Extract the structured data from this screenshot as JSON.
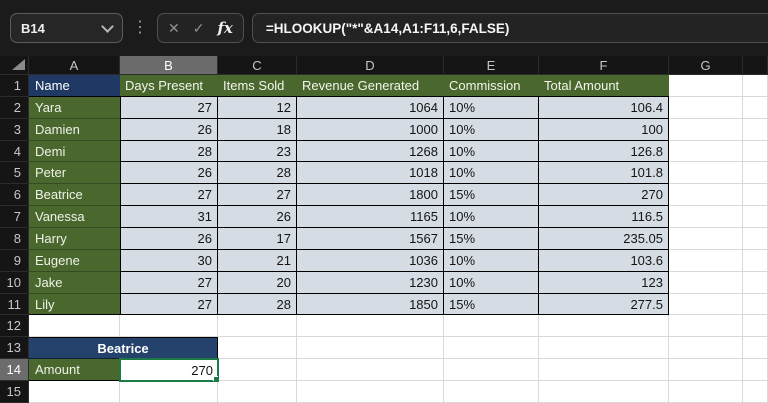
{
  "formula_bar": {
    "name_box_value": "B14",
    "kebab_icon": "⋮",
    "cancel_icon": "✕",
    "confirm_icon": "✓",
    "fx_icon": "fx",
    "formula": "=HLOOKUP(\"*\"&A14,A1:F11,6,FALSE)"
  },
  "sheet": {
    "column_headers": [
      "A",
      "B",
      "C",
      "D",
      "E",
      "F",
      "G",
      ""
    ],
    "row_headers": [
      "1",
      "2",
      "3",
      "4",
      "5",
      "6",
      "7",
      "8",
      "9",
      "10",
      "11",
      "12",
      "13",
      "14",
      "15"
    ],
    "selection": {
      "cell_ref": "B14",
      "column": "B",
      "row": "14"
    },
    "table": {
      "title_cell": "Name",
      "columns": [
        "Days Present",
        "Items Sold",
        "Revenue Generated",
        "Commission",
        "Total Amount"
      ],
      "rows": [
        {
          "name": "Yara",
          "values": [
            "27",
            "12",
            "1064",
            "10%",
            "106.4"
          ]
        },
        {
          "name": "Damien",
          "values": [
            "26",
            "18",
            "1000",
            "10%",
            "100"
          ]
        },
        {
          "name": "Demi",
          "values": [
            "28",
            "23",
            "1268",
            "10%",
            "126.8"
          ]
        },
        {
          "name": "Peter",
          "values": [
            "26",
            "28",
            "1018",
            "10%",
            "101.8"
          ]
        },
        {
          "name": "Beatrice",
          "values": [
            "27",
            "27",
            "1800",
            "15%",
            "270"
          ]
        },
        {
          "name": "Vanessa",
          "values": [
            "31",
            "26",
            "1165",
            "10%",
            "116.5"
          ]
        },
        {
          "name": "Harry",
          "values": [
            "26",
            "17",
            "1567",
            "15%",
            "235.05"
          ]
        },
        {
          "name": "Eugene",
          "values": [
            "30",
            "21",
            "1036",
            "10%",
            "103.6"
          ]
        },
        {
          "name": "Jake",
          "values": [
            "27",
            "20",
            "1230",
            "10%",
            "123"
          ]
        },
        {
          "name": "Lily",
          "values": [
            "27",
            "28",
            "1850",
            "15%",
            "277.5"
          ]
        }
      ]
    },
    "lookup_panel": {
      "header": "Beatrice",
      "label": "Amount",
      "value": "270"
    }
  },
  "colors": {
    "accent_green_selection": "#1b7a45",
    "header_fill_green": "#4a682e",
    "header_fill_navy": "#1f3864",
    "merged_fill_navy": "#24426b",
    "data_fill": "#d6dce4"
  }
}
